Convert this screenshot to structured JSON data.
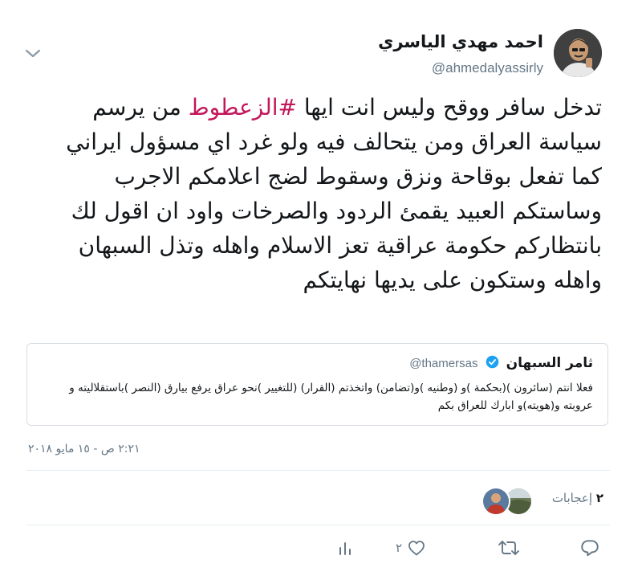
{
  "author": {
    "name": "احمد مهدي الياسري",
    "handle": "@ahmedalyassirly"
  },
  "tweet": {
    "text_before_hashtag": "تدخل سافر ووقح وليس انت ايها ",
    "hashtag": "#الزعطوط",
    "text_after_hashtag": " من يرسم سياسة العراق ومن يتحالف فيه ولو غرد اي مسؤول ايراني كما تفعل بوقاحة ونزق وسقوط لضج اعلامكم الاجرب وساستكم العبيد يقمئ الردود والصرخات واود ان اقول لك بانتظاركم حكومة عراقية تعز الاسلام واهله وتذل السبهان واهله وستكون على يديها نهايتكم",
    "timestamp": "٢:٢١ ص - ١٥ مايو ٢٠١٨"
  },
  "quoted_tweet": {
    "name": "ثامر السبهان",
    "handle": "@thamersas",
    "verified": true,
    "text": "فعلا انتم (سائرون )(بحكمة )و (وطنيه )و(تضامن) واتخذتم (القرار) (للتغيير )نحو عراق يرفع بيارق (النصر )باستقلاليته و عروبته و(هويته)و ابارك للعراق بكم"
  },
  "likes": {
    "count": "٢",
    "label": "إعجابات"
  },
  "actions": {
    "like_count": "٢"
  },
  "icons": {
    "caret": "chevron-down-icon",
    "verified": "verified-badge-icon",
    "reply": "reply-icon",
    "retweet": "retweet-icon",
    "like": "heart-icon",
    "dm": "direct-message-icon"
  },
  "colors": {
    "hashtag": "#c2185b",
    "muted": "#657786",
    "text": "#14171a",
    "verified": "#1da1f2",
    "border": "#e6ecf0"
  }
}
